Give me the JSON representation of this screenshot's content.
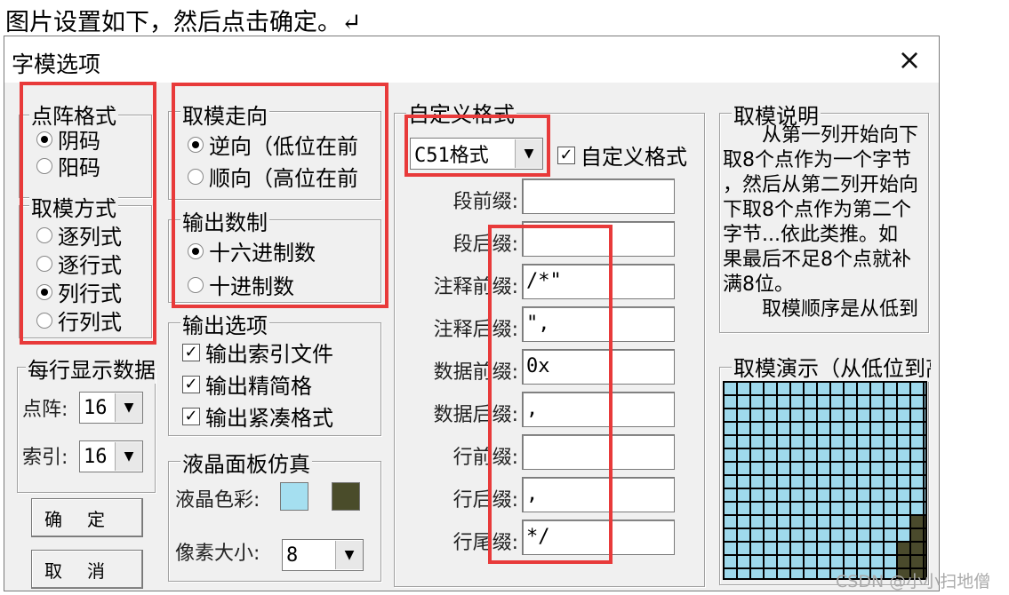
{
  "caption": "图片设置如下，然后点击确定。↵",
  "dialog": {
    "title": "字模选项",
    "close_icon": "×"
  },
  "dot_format": {
    "legend": "点阵格式",
    "options": [
      {
        "label": "阴码",
        "selected": true
      },
      {
        "label": "阳码",
        "selected": false
      }
    ]
  },
  "scan_mode": {
    "legend": "取模方式",
    "options": [
      {
        "label": "逐列式",
        "selected": false
      },
      {
        "label": "逐行式",
        "selected": false
      },
      {
        "label": "列行式",
        "selected": true
      },
      {
        "label": "行列式",
        "selected": false
      }
    ]
  },
  "per_row": {
    "legend": "每行显示数据",
    "dot_label": "点阵:",
    "dot_value": "16",
    "index_label": "索引:",
    "index_value": "16"
  },
  "buttons": {
    "ok": "确定",
    "cancel": "取消"
  },
  "direction": {
    "legend": "取模走向",
    "options": [
      {
        "label": "逆向（低位在前",
        "selected": true
      },
      {
        "label": "顺向（高位在前",
        "selected": false
      }
    ]
  },
  "radix": {
    "legend": "输出数制",
    "options": [
      {
        "label": "十六进制数",
        "selected": true
      },
      {
        "label": "十进制数",
        "selected": false
      }
    ]
  },
  "output_options": {
    "legend": "输出选项",
    "items": [
      {
        "label": "输出索引文件",
        "checked": true
      },
      {
        "label": "输出精简格",
        "checked": true
      },
      {
        "label": "输出紧凑格式",
        "checked": true
      }
    ]
  },
  "lcd": {
    "legend": "液晶面板仿真",
    "color_label": "液晶色彩:",
    "size_label": "像素大小:",
    "size_value": "8",
    "colors": {
      "light": "#a5dff0",
      "dark": "#4a4c2a"
    }
  },
  "custom_format": {
    "legend": "自定义格式",
    "format_value": "C51格式",
    "custom_checkbox_label": "自定义格式",
    "custom_checked": true,
    "fields": [
      {
        "label": "段前缀:",
        "value": ""
      },
      {
        "label": "段后缀:",
        "value": ""
      },
      {
        "label": "注释前缀:",
        "value": "/*\""
      },
      {
        "label": "注释后缀:",
        "value": "\","
      },
      {
        "label": "数据前缀:",
        "value": "0x"
      },
      {
        "label": "数据后缀:",
        "value": ","
      },
      {
        "label": "行前缀:",
        "value": ""
      },
      {
        "label": "行后缀:",
        "value": ","
      },
      {
        "label": "行尾缀:",
        "value": "*/"
      }
    ]
  },
  "description": {
    "legend": "取模说明",
    "lines": [
      "　　从第一列开始向下",
      "取8个点作为一个字节",
      "，然后从第二列开始向",
      "下取8个点作为第二个",
      "字节...依此类推。如",
      "果最后不足8个点就补",
      "满8位。",
      "　　取模顺序是从低到"
    ]
  },
  "demo": {
    "legend": "取模演示（从低位到高"
  },
  "watermark": "CSDN @小小扫地僧",
  "colors": {
    "highlight": "#e83a3a",
    "dialog_bg": "#f0f0f0"
  }
}
